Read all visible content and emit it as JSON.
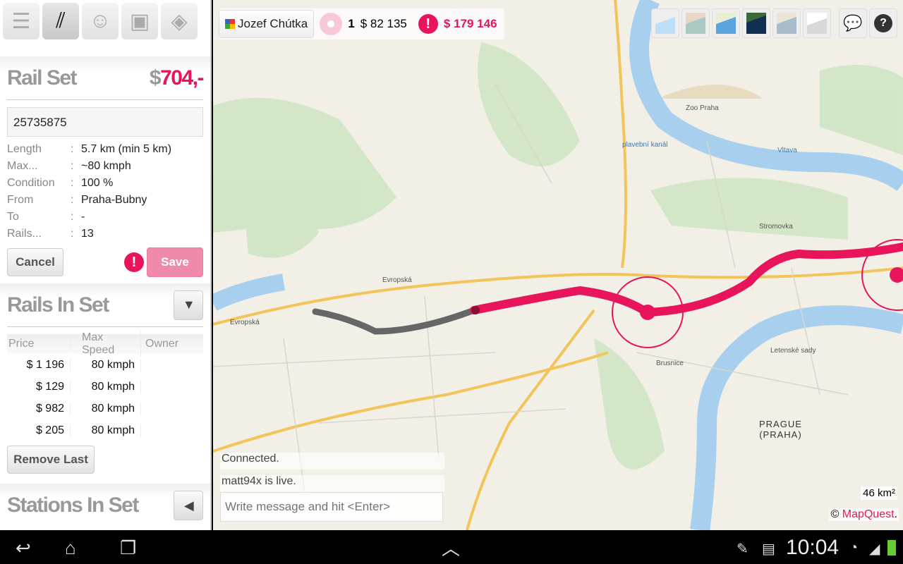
{
  "toolbar": {
    "tools": [
      {
        "icon": "rail-track-icon"
      },
      {
        "icon": "curved-rail-icon",
        "selected": true
      },
      {
        "icon": "passenger-icon"
      },
      {
        "icon": "train-icon"
      },
      {
        "icon": "signal-icon"
      }
    ]
  },
  "rail_set": {
    "title": "Rail Set",
    "currency": "$",
    "price": "704,-",
    "id_value": "25735875",
    "fields": [
      {
        "label": "Length",
        "value": "5.7 km (min 5 km)"
      },
      {
        "label": "Max...",
        "value": "~80 kmph"
      },
      {
        "label": "Condition",
        "value": "100 %"
      },
      {
        "label": "From",
        "value": "Praha-Bubny"
      },
      {
        "label": "To",
        "value": "-"
      },
      {
        "label": "Rails...",
        "value": "13"
      }
    ],
    "cancel": "Cancel",
    "save": "Save",
    "warning": "!"
  },
  "rails_in_set": {
    "title": "Rails In Set",
    "columns": [
      "Price",
      "Max Speed",
      "Owner"
    ],
    "rows": [
      [
        "$ 1 196",
        "80 kmph",
        ""
      ],
      [
        "$ 129",
        "80 kmph",
        ""
      ],
      [
        "$ 982",
        "80 kmph",
        ""
      ],
      [
        "$ 205",
        "80 kmph",
        ""
      ]
    ],
    "remove_last": "Remove Last"
  },
  "stations_in_set": {
    "title": "Stations In Set"
  },
  "map": {
    "user": "Jozef Chútka",
    "count": "1",
    "money": "$ 82 135",
    "debt": "$ 179 146",
    "accent": "#e8145c",
    "labels": {
      "city": "PRAGUE",
      "city_local": "(PRAHA)",
      "area": "46 km²",
      "copyright": "©",
      "provider": "MapQuest",
      "road1": "Evropská",
      "road2": "Evropská",
      "river": "Vltava",
      "park": "Stromovka",
      "park2": "Letenské sady",
      "zoo": "Zoo Praha",
      "street": "Brusnice",
      "canal": "plavební kanál"
    }
  },
  "chat": {
    "messages": [
      "Connected.",
      "matt94x is live."
    ],
    "placeholder": "Write message and hit <Enter>"
  },
  "statusbar": {
    "time": "10:04"
  }
}
